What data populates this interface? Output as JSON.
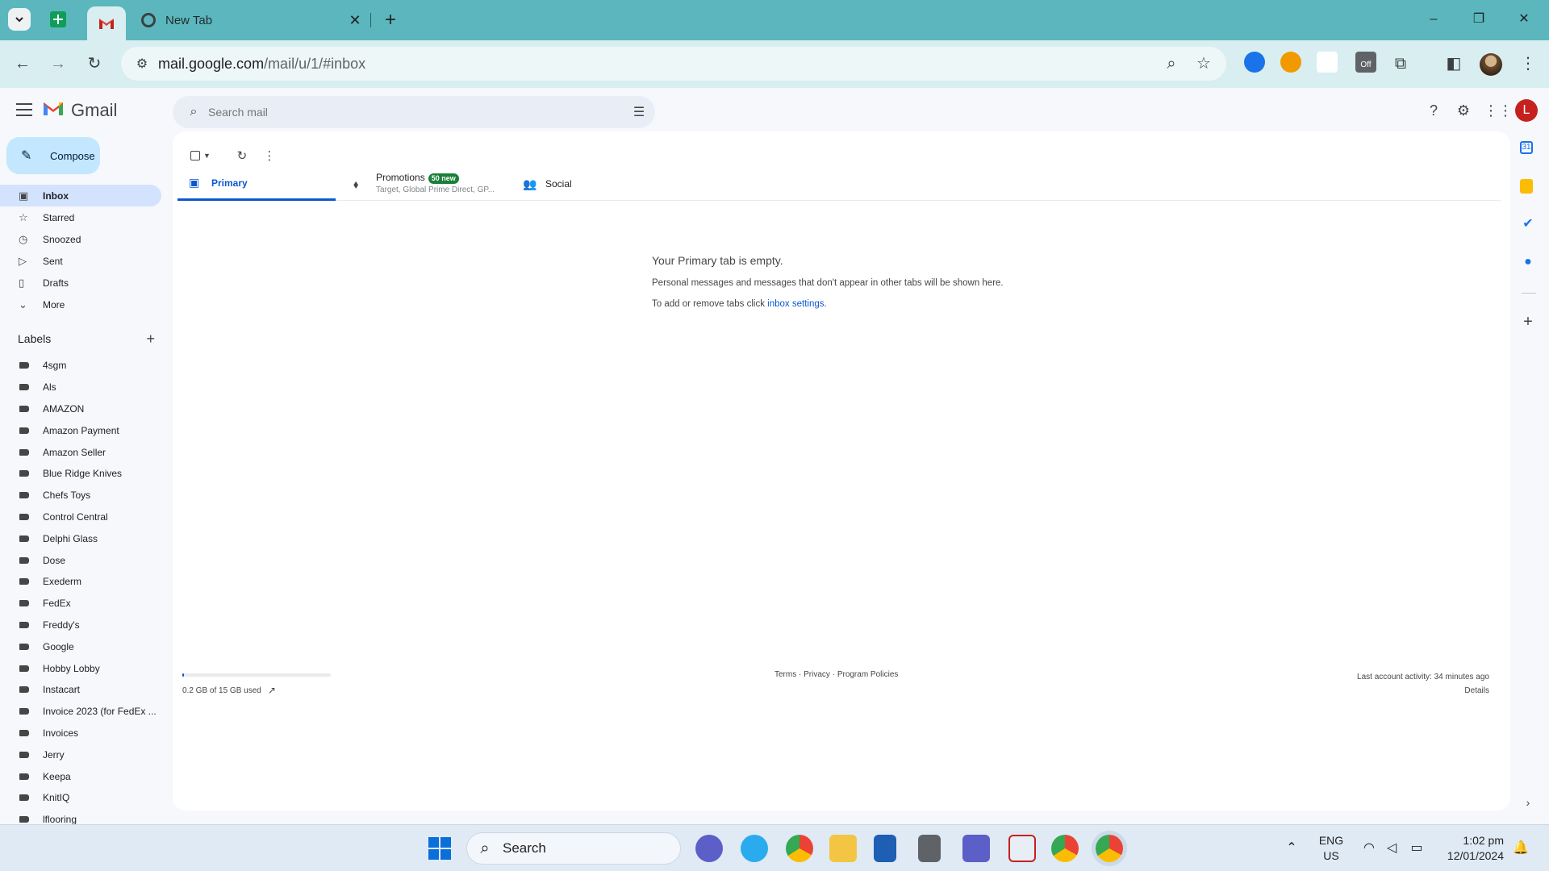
{
  "browser": {
    "tabs": [
      {
        "label": "Gmail",
        "pinned": true
      },
      {
        "label": "New Tab"
      }
    ],
    "new_tab_symbol": "+",
    "close_symbol": "✕",
    "url_host": "mail.google.com",
    "url_path": "/mail/u/1/#inbox",
    "window_controls": [
      "–",
      "❐",
      "✕"
    ],
    "ext_badge": "Off"
  },
  "gmail": {
    "app_name": "Gmail",
    "search_placeholder": "Search mail",
    "user_initial": "L",
    "compose_label": "Compose",
    "nav": [
      {
        "label": "Inbox",
        "icon": "inbox-icon",
        "glyph": "▣",
        "active": true
      },
      {
        "label": "Starred",
        "icon": "star-icon",
        "glyph": "☆"
      },
      {
        "label": "Snoozed",
        "icon": "clock-icon",
        "glyph": "◷"
      },
      {
        "label": "Sent",
        "icon": "send-icon",
        "glyph": "▷"
      },
      {
        "label": "Drafts",
        "icon": "draft-icon",
        "glyph": "▯"
      },
      {
        "label": "More",
        "icon": "chevron-down-icon",
        "glyph": "⌄"
      }
    ],
    "labels_title": "Labels",
    "labels": [
      "4sgm",
      "Als",
      "AMAZON",
      "Amazon Payment",
      "Amazon Seller",
      "Blue Ridge Knives",
      "Chefs Toys",
      "Control Central",
      "Delphi Glass",
      "Dose",
      "Exederm",
      "FedEx",
      "Freddy's",
      "Google",
      "Hobby Lobby",
      "Instacart",
      "Invoice 2023 (for FedEx ...",
      "Invoices",
      "Jerry",
      "Keepa",
      "KnitIQ",
      "lflooring"
    ],
    "tabs": {
      "primary": "Primary",
      "promotions": "Promotions",
      "promotions_badge": "50 new",
      "promotions_sub": "Target, Global Prime Direct, GP...",
      "social": "Social"
    },
    "empty": {
      "heading": "Your Primary tab is empty.",
      "line1": "Personal messages and messages that don't appear in other tabs will be shown here.",
      "line2_prefix": "To add or remove tabs click ",
      "line2_link": "inbox settings",
      "line2_suffix": "."
    },
    "storage": {
      "text": "0.2 GB of 15 GB used",
      "used_fraction": 0.013
    },
    "footer": {
      "links": [
        "Terms",
        "Privacy",
        "Program Policies"
      ],
      "activity": "Last account activity: 34 minutes ago",
      "details": "Details"
    }
  },
  "taskbar": {
    "search_label": "Search",
    "lang_top": "ENG",
    "lang_bottom": "US",
    "time": "1:02 pm",
    "date": "12/01/2024"
  },
  "colors": {
    "tabbar": "#5bb7bd",
    "toolbar": "#d8eef0",
    "accent": "#0b57d0",
    "compose": "#c2e7ff",
    "active_nav": "#d3e3fd"
  }
}
